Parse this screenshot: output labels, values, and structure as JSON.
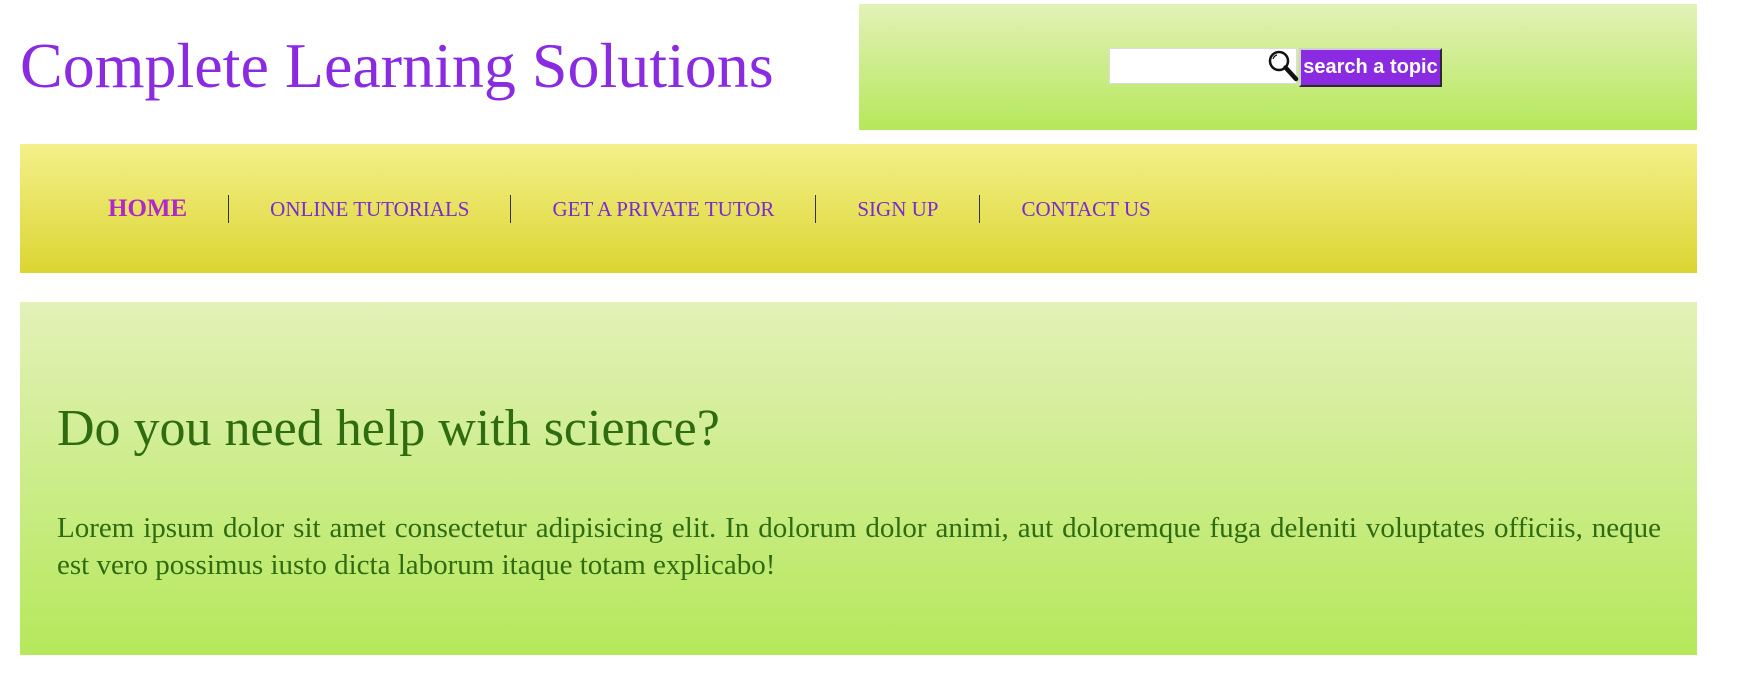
{
  "header": {
    "site_title": "Complete Learning Solutions"
  },
  "search": {
    "value": "",
    "placeholder": "",
    "icon": "search-icon",
    "button_label": "search a topic"
  },
  "nav": {
    "items": [
      {
        "label": "HOME",
        "active": true
      },
      {
        "label": "ONLINE TUTORIALS",
        "active": false
      },
      {
        "label": "GET A PRIVATE TUTOR",
        "active": false
      },
      {
        "label": "SIGN UP",
        "active": false
      },
      {
        "label": "CONTACT US",
        "active": false
      }
    ]
  },
  "hero": {
    "heading": "Do you need help with science?",
    "body": "Lorem ipsum dolor sit amet consectetur adipisicing elit. In dolorum dolor animi, aut doloremque fuga deleniti voluptates officiis, neque est vero possimus iusto dicta laborum itaque totam explicabo!"
  },
  "colors": {
    "accent_purple": "#8a2be2",
    "nav_text": "#7a2bd0",
    "active_nav": "#b028c9",
    "hero_text": "#2f6b10",
    "green_gradient_top": "#e3f1b8",
    "green_gradient_bottom": "#b5e85b",
    "yellow_gradient_top": "#f4f08a",
    "yellow_gradient_bottom": "#dbd532"
  }
}
